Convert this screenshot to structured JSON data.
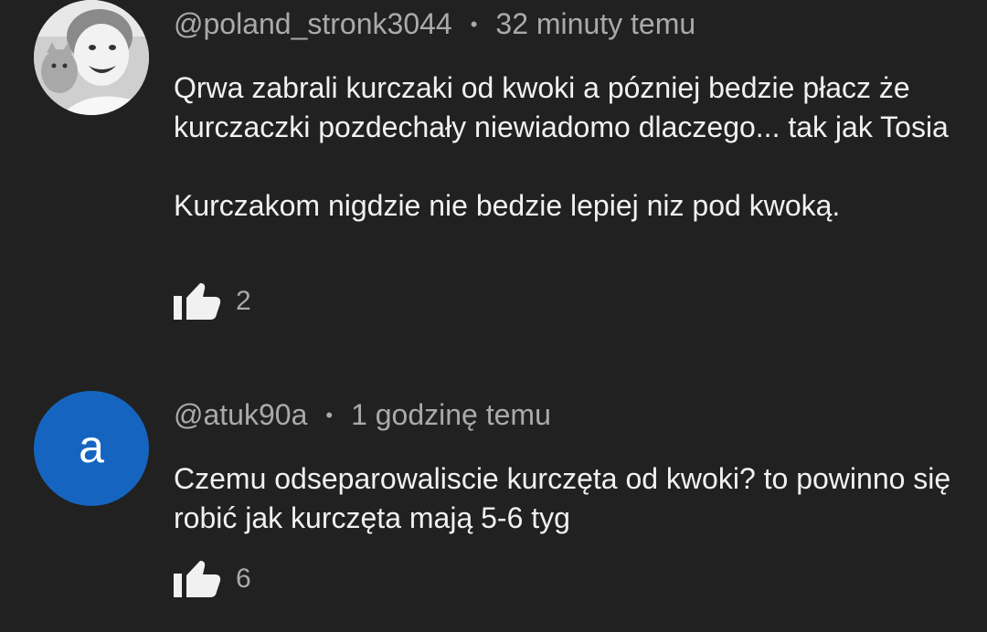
{
  "comments": [
    {
      "author": "@poland_stronk3044",
      "time": "32 minuty temu",
      "separator": "•",
      "paragraphs": [
        "Qrwa zabrali kurczaki od kwoki a pózniej bedzie płacz że kurczaczki pozdechały niewiadomo dlaczego... tak jak Tosia",
        "Kurczakom nigdzie nie bedzie lepiej niz pod kwoką."
      ],
      "likes": "2",
      "avatar_type": "photo"
    },
    {
      "author": "@atuk90a",
      "time": "1 godzinę temu",
      "separator": "•",
      "paragraphs": [
        "Czemu odseparowaliscie kurczęta od kwoki? to powinno się robić jak kurczęta mają 5-6 tyg"
      ],
      "likes": "6",
      "avatar_letter": "a",
      "avatar_color": "#1565c0"
    }
  ],
  "icons": {
    "like": "thumbs-up-icon"
  }
}
